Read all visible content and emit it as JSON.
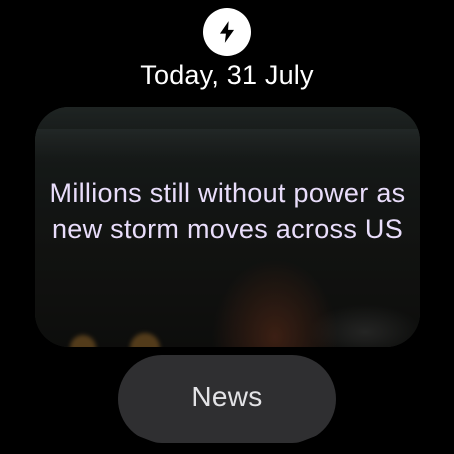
{
  "header": {
    "icon": "lightning-bolt-icon",
    "date": "Today, 31 July"
  },
  "card": {
    "headline": "Millions still without power as new storm moves across US"
  },
  "chip": {
    "label": "News"
  },
  "colors": {
    "background": "#000000",
    "headline_text": "#e9ddfb",
    "chip_background": "#2f2f31",
    "icon_background": "#ffffff"
  }
}
